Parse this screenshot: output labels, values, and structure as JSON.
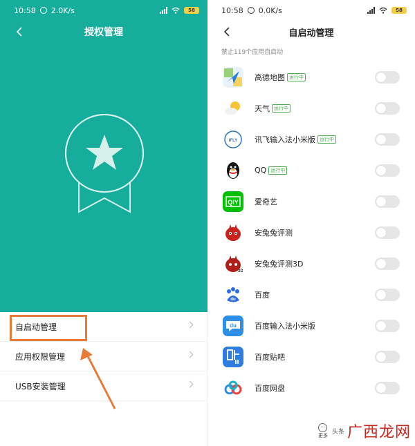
{
  "left": {
    "status": {
      "time": "10:58",
      "speed": "2.0K/s",
      "battery": "58"
    },
    "title": "授权管理",
    "menu": [
      {
        "label": "自启动管理"
      },
      {
        "label": "应用权限管理"
      },
      {
        "label": "USB安装管理"
      }
    ]
  },
  "right": {
    "status": {
      "time": "10:58",
      "speed": "0.0K/s",
      "battery": "58"
    },
    "title": "自启动管理",
    "subheading": "禁止119个应用自启动",
    "running_tag": "运行中",
    "apps": [
      {
        "name": "高德地图",
        "running": true,
        "icon": "amap-icon"
      },
      {
        "name": "天气",
        "running": true,
        "icon": "weather-icon"
      },
      {
        "name": "讯飞输入法小米版",
        "running": true,
        "icon": "iflytek-icon"
      },
      {
        "name": "QQ",
        "running": true,
        "icon": "qq-icon"
      },
      {
        "name": "爱奇艺",
        "running": false,
        "icon": "iqiyi-icon"
      },
      {
        "name": "安兔兔评测",
        "running": false,
        "icon": "antutu-icon"
      },
      {
        "name": "安兔兔评测3D",
        "running": false,
        "icon": "antutu3d-icon"
      },
      {
        "name": "百度",
        "running": false,
        "icon": "baidu-icon"
      },
      {
        "name": "百度输入法小米版",
        "running": false,
        "icon": "baidu-ime-icon"
      },
      {
        "name": "百度贴吧",
        "running": false,
        "icon": "tieba-icon"
      },
      {
        "name": "百度网盘",
        "running": false,
        "icon": "baidu-pan-icon"
      }
    ]
  },
  "watermark": {
    "more": "更多",
    "source": "头条",
    "brand": "广西龙网"
  },
  "colors": {
    "teal": "#16ad9c",
    "highlight": "#e87b3a",
    "running_tag": "#4caf50"
  }
}
